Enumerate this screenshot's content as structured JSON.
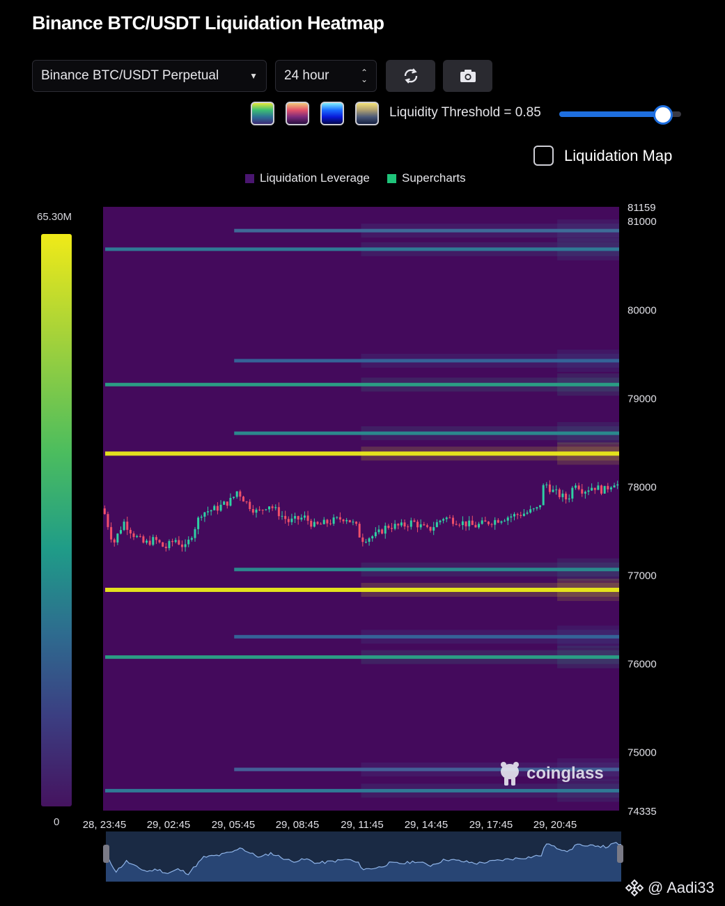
{
  "header": {
    "title": "Binance BTC/USDT Liquidation Heatmap"
  },
  "controls": {
    "market": "Binance BTC/USDT Perpetual",
    "range": "24 hour",
    "refresh_icon": "refresh-icon",
    "camera_icon": "camera-icon",
    "threshold_label": "Liquidity Threshold = 0.85",
    "threshold_value": 0.85,
    "liquidation_map_label": "Liquidation Map",
    "liquidation_map_checked": false
  },
  "colors": {
    "background": "#000000",
    "heatmap_base": "#440a5c",
    "accent": "#1e6fe0",
    "legend_leverage": "#4a1670",
    "legend_supercharts": "#1fc47a"
  },
  "colorbar": {
    "max_label": "65.30M",
    "min_label": "0"
  },
  "watermark": "coinglass",
  "credit": "@ Aadi33",
  "chart_data": {
    "type": "heatmap",
    "title": "Binance BTC/USDT Liquidation Heatmap",
    "legend": [
      "Liquidation Leverage",
      "Supercharts"
    ],
    "legend_position": "top-center",
    "ylim": [
      74335,
      81159
    ],
    "y_ticks": [
      81159,
      81000,
      80000,
      79000,
      78000,
      77000,
      76000,
      75000,
      74335
    ],
    "x_ticks": [
      "28, 23:45",
      "29, 02:45",
      "29, 05:45",
      "29, 08:45",
      "29, 11:45",
      "29, 14:45",
      "29, 17:45",
      "29, 20:45"
    ],
    "liquidation_levels": [
      {
        "price": 80890,
        "start": 0.25,
        "intensity": 0.35,
        "color": "#3f6f9a"
      },
      {
        "price": 80680,
        "start": 0.0,
        "intensity": 0.5,
        "color": "#2f7f98"
      },
      {
        "price": 79420,
        "start": 0.25,
        "intensity": 0.4,
        "color": "#35679a"
      },
      {
        "price": 79150,
        "start": 0.0,
        "intensity": 0.7,
        "color": "#2aa486"
      },
      {
        "price": 78600,
        "start": 0.25,
        "intensity": 0.6,
        "color": "#2b8f8f"
      },
      {
        "price": 78370,
        "start": 0.0,
        "intensity": 1.0,
        "color": "#ecec1a"
      },
      {
        "price": 77060,
        "start": 0.25,
        "intensity": 0.6,
        "color": "#2b8f8f"
      },
      {
        "price": 76830,
        "start": 0.0,
        "intensity": 1.0,
        "color": "#ecec1a"
      },
      {
        "price": 76300,
        "start": 0.25,
        "intensity": 0.45,
        "color": "#35679a"
      },
      {
        "price": 76070,
        "start": 0.0,
        "intensity": 0.7,
        "color": "#2aa486"
      },
      {
        "price": 74800,
        "start": 0.25,
        "intensity": 0.3,
        "color": "#45659a"
      },
      {
        "price": 74560,
        "start": 0.0,
        "intensity": 0.5,
        "color": "#2f7f98"
      }
    ],
    "price_path": [
      {
        "t": 0.0,
        "p": 77750
      },
      {
        "t": 0.02,
        "p": 77350
      },
      {
        "t": 0.04,
        "p": 77600
      },
      {
        "t": 0.06,
        "p": 77450
      },
      {
        "t": 0.08,
        "p": 77350
      },
      {
        "t": 0.1,
        "p": 77400
      },
      {
        "t": 0.12,
        "p": 77300
      },
      {
        "t": 0.14,
        "p": 77400
      },
      {
        "t": 0.16,
        "p": 77300
      },
      {
        "t": 0.19,
        "p": 77700
      },
      {
        "t": 0.22,
        "p": 77750
      },
      {
        "t": 0.25,
        "p": 77850
      },
      {
        "t": 0.26,
        "p": 77950
      },
      {
        "t": 0.28,
        "p": 77800
      },
      {
        "t": 0.3,
        "p": 77700
      },
      {
        "t": 0.32,
        "p": 77800
      },
      {
        "t": 0.34,
        "p": 77700
      },
      {
        "t": 0.36,
        "p": 77600
      },
      {
        "t": 0.39,
        "p": 77650
      },
      {
        "t": 0.41,
        "p": 77550
      },
      {
        "t": 0.44,
        "p": 77600
      },
      {
        "t": 0.47,
        "p": 77650
      },
      {
        "t": 0.49,
        "p": 77550
      },
      {
        "t": 0.5,
        "p": 77400
      },
      {
        "t": 0.53,
        "p": 77450
      },
      {
        "t": 0.55,
        "p": 77550
      },
      {
        "t": 0.58,
        "p": 77550
      },
      {
        "t": 0.6,
        "p": 77600
      },
      {
        "t": 0.63,
        "p": 77500
      },
      {
        "t": 0.66,
        "p": 77650
      },
      {
        "t": 0.69,
        "p": 77600
      },
      {
        "t": 0.72,
        "p": 77550
      },
      {
        "t": 0.75,
        "p": 77600
      },
      {
        "t": 0.78,
        "p": 77650
      },
      {
        "t": 0.82,
        "p": 77700
      },
      {
        "t": 0.845,
        "p": 77750
      },
      {
        "t": 0.855,
        "p": 78050
      },
      {
        "t": 0.87,
        "p": 77950
      },
      {
        "t": 0.9,
        "p": 77850
      },
      {
        "t": 0.915,
        "p": 78050
      },
      {
        "t": 0.93,
        "p": 77950
      },
      {
        "t": 0.95,
        "p": 78000
      },
      {
        "t": 0.97,
        "p": 77950
      },
      {
        "t": 0.99,
        "p": 78050
      },
      {
        "t": 1.0,
        "p": 78000
      }
    ]
  }
}
